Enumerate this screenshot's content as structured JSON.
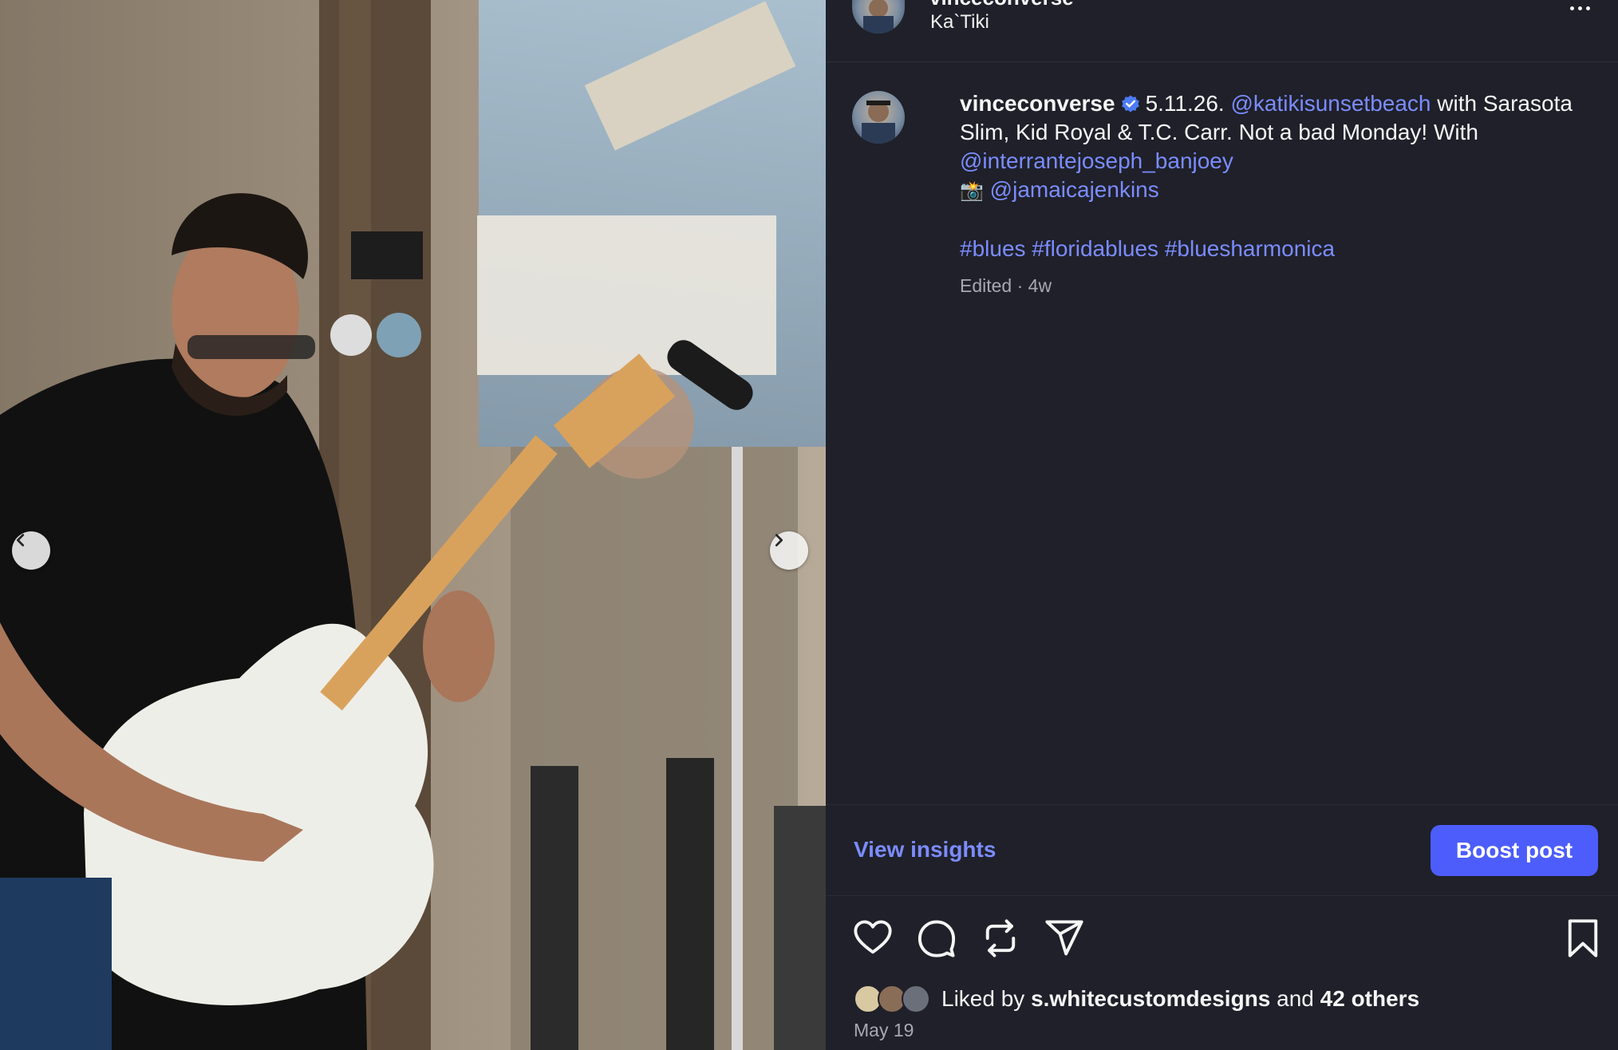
{
  "post": {
    "username": "vinceconverse",
    "location": "Ka`Tiki",
    "caption": {
      "username": "vinceconverse",
      "text_1": "5.11.26. ",
      "mention_1": "@katikisunsetbeach",
      "text_2": " with Sarasota Slim, Kid Royal & T.C. Carr. Not a bad Monday! With ",
      "mention_2": "@interrantejoseph_banjoey",
      "camera_emoji": "📸",
      "mention_3": "@jamaicajenkins",
      "hashtags": "#blues #floridablues #bluesharmonica"
    },
    "meta": "Edited · 4w",
    "view_insights": "View insights",
    "boost_post": "Boost post",
    "liked_by_prefix": "Liked by ",
    "liked_by_user": "s.whitecustomdesigns",
    "liked_by_and": " and ",
    "liked_by_others": "42 others",
    "date": "May 19"
  },
  "icons": {
    "more": "more-horizontal-icon",
    "verified": "verified-badge-icon",
    "like": "heart-icon",
    "comment": "comment-bubble-icon",
    "repost": "repost-icon",
    "share": "paper-plane-icon",
    "save": "bookmark-icon",
    "prev": "chevron-left-icon",
    "next": "chevron-right-icon"
  },
  "colors": {
    "background": "#1f2029",
    "link": "#7b8cff",
    "boost_button": "#4d5dfb",
    "verified": "#4d7cf6"
  }
}
